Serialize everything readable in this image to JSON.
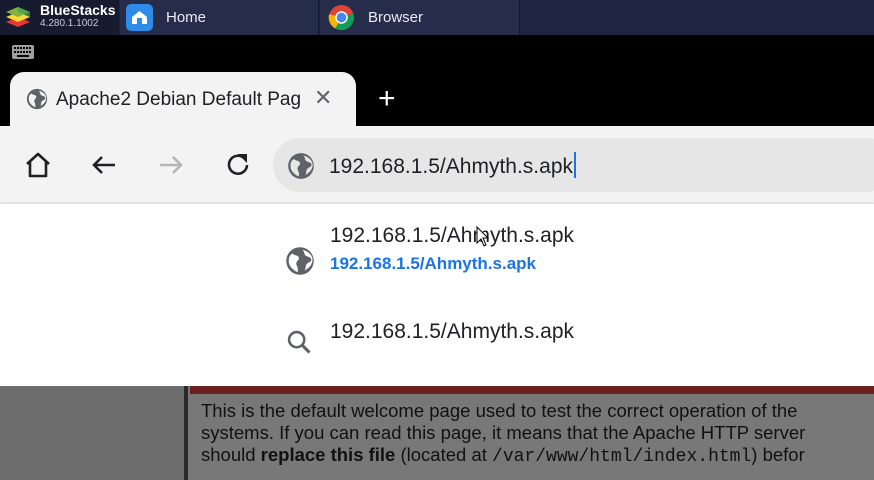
{
  "bluestacks": {
    "name": "BlueStacks",
    "version": "4.280.1.1002",
    "tabs": [
      {
        "label": "Home",
        "icon": "home-icon"
      },
      {
        "label": "Browser",
        "icon": "chrome-icon"
      }
    ]
  },
  "chrome": {
    "tab": {
      "title": "Apache2 Debian Default Pag",
      "close_icon": "close-icon"
    },
    "new_tab_symbol": "+",
    "omnibox": {
      "value": "192.168.1.5/Ahmyth.s.apk"
    },
    "suggestions": [
      {
        "title": "192.168.1.5/Ahmyth.s.apk",
        "url": "192.168.1.5/Ahmyth.s.apk",
        "icon": "globe-icon"
      },
      {
        "title": "192.168.1.5/Ahmyth.s.apk",
        "icon": "search-icon"
      }
    ]
  },
  "page": {
    "line1": "This is the default welcome page used to test the correct operation of the",
    "line2": "systems. If you can read this page, it means that the Apache HTTP server",
    "line3_prefix": "should ",
    "line3_bold": "replace this file",
    "line3_mid": " (located at ",
    "line3_code": "/var/www/html/index.html",
    "line3_suffix": ") befor"
  },
  "colors": {
    "accent": "#1a73e8",
    "toolbar_bg": "#f3f3f3",
    "bluestacks_bar": "#1f2540"
  }
}
